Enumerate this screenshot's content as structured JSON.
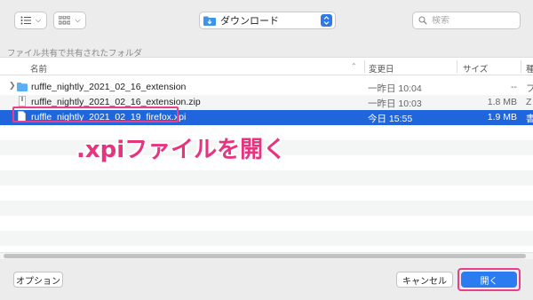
{
  "toolbar": {
    "view_icon": "list-icon",
    "group_icon": "grid-icon",
    "location": "ダウンロード",
    "search_placeholder": "検索"
  },
  "sidebar_title": "ファイル共有で共有されたフォルダ",
  "columns": {
    "name": "名前",
    "modified": "変更日",
    "size": "サイズ",
    "kind": "種"
  },
  "files": [
    {
      "name": "ruffle_nightly_2021_02_16_extension",
      "date": "一昨日 10:04",
      "size": "--",
      "kind": "フ",
      "type": "folder"
    },
    {
      "name": "ruffle_nightly_2021_02_16_extension.zip",
      "date": "一昨日 10:03",
      "size": "1.8 MB",
      "kind": "Z",
      "type": "zip"
    },
    {
      "name": "ruffle_nightly_2021_02_19_firefox.xpi",
      "date": "今日 15:55",
      "size": "1.9 MB",
      "kind": "書",
      "type": "file"
    }
  ],
  "annotation": ".xpiファイルを開く",
  "buttons": {
    "options": "オプション",
    "cancel": "キャンセル",
    "open": "開く"
  },
  "colors": {
    "selection": "#1f66dc",
    "highlight": "#ea3d8a",
    "accent": "#2b7cf0"
  }
}
